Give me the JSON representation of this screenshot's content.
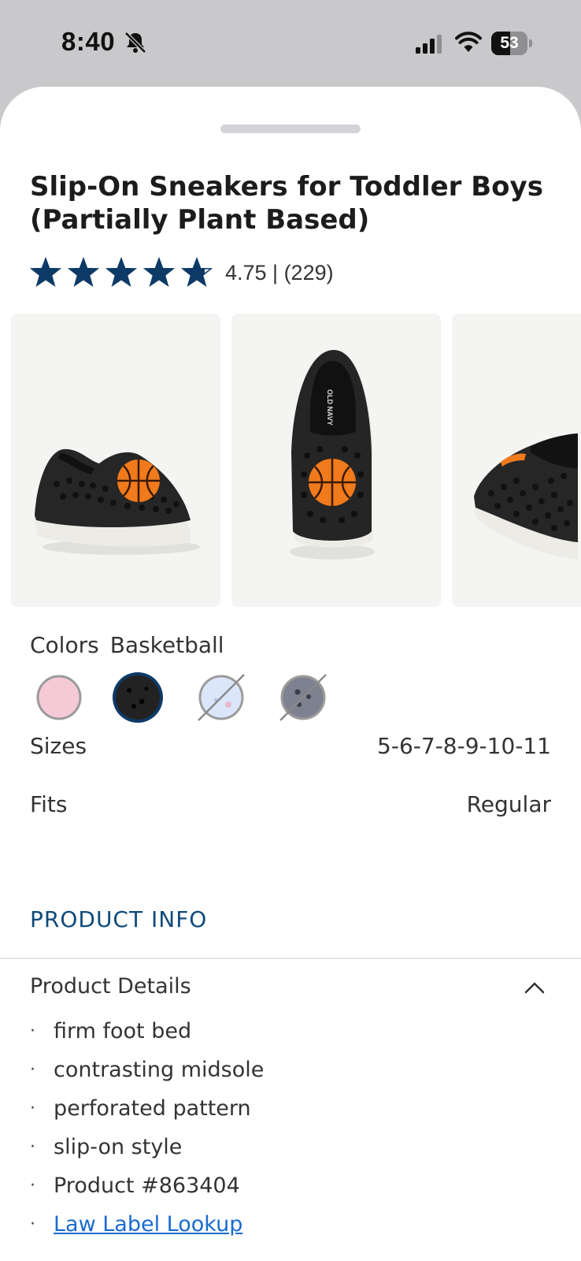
{
  "status_bar": {
    "time": "8:40",
    "battery_level": "53",
    "battery_fraction": 0.53
  },
  "product": {
    "title": "Slip-On Sneakers for Toddler Boys (Partially Plant Based)",
    "rating_stars": 4.75,
    "rating_text": "4.75 | (229)",
    "star_color": "#0d3a66"
  },
  "gallery": {
    "images": [
      {
        "icon": "shoe-side-view-image"
      },
      {
        "icon": "shoe-top-view-image",
        "brand_print": "OLD NAVY"
      },
      {
        "icon": "shoe-partial-view-image"
      }
    ]
  },
  "colors": {
    "label": "Colors",
    "selected_name": "Basketball",
    "swatches": [
      {
        "name": "pink",
        "hex": "#f6c9d6",
        "available": true,
        "selected": false
      },
      {
        "name": "black",
        "hex": "#222222",
        "available": true,
        "selected": true
      },
      {
        "name": "light-blue",
        "hex": "#dce6fb",
        "available": false,
        "selected": false
      },
      {
        "name": "gray",
        "hex": "#7e8190",
        "available": false,
        "selected": false
      }
    ]
  },
  "specs": {
    "sizes_label": "Sizes",
    "sizes_value": "5-6-7-8-9-10-11",
    "fits_label": "Fits",
    "fits_value": "Regular"
  },
  "product_info": {
    "heading": "PRODUCT INFO",
    "details_title": "Product Details",
    "details": [
      "firm foot bed",
      "contrasting midsole",
      "perforated pattern",
      "slip-on style",
      "Product #863404"
    ],
    "link_label": "Law Label Lookup"
  },
  "accent_colors": {
    "heading": "#0f4a7a",
    "link": "#1a6bd0",
    "basketball": "#f07a1c"
  }
}
